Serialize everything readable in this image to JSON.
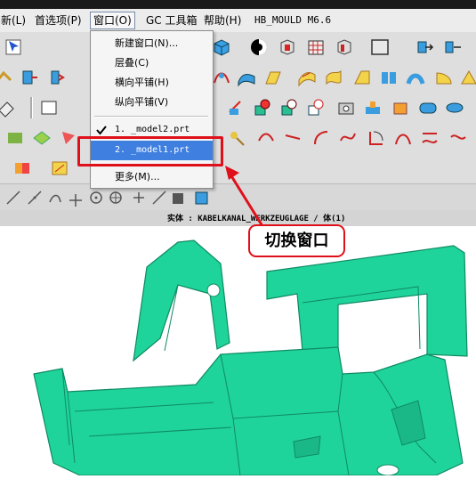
{
  "menubar": {
    "items": [
      {
        "label": "新(L)"
      },
      {
        "label": "首选项(P)"
      },
      {
        "label": "窗口(O)"
      },
      {
        "label": "GC 工具箱"
      },
      {
        "label": "帮助(H)"
      },
      {
        "label": "HB_MOULD M6.6"
      }
    ]
  },
  "window_menu": {
    "items": [
      {
        "label": "新建窗口(N)..."
      },
      {
        "label": "层叠(C)"
      },
      {
        "label": "横向平铺(H)"
      },
      {
        "label": "纵向平铺(V)"
      },
      {
        "label": "1. _model2.prt",
        "checked": true
      },
      {
        "label": "2. _model1.prt",
        "selected": true
      },
      {
        "label": "更多(M)..."
      }
    ]
  },
  "status": {
    "text": "实体 : KABELKANAL_WERKZEUGLAGE / 体(1)"
  },
  "annotation": {
    "callout": "切换窗口",
    "color": "#e0101a"
  },
  "colors": {
    "model": "#1fd49a",
    "model_dark": "#0f8a63",
    "menu_highlight": "#3f7fe0"
  }
}
